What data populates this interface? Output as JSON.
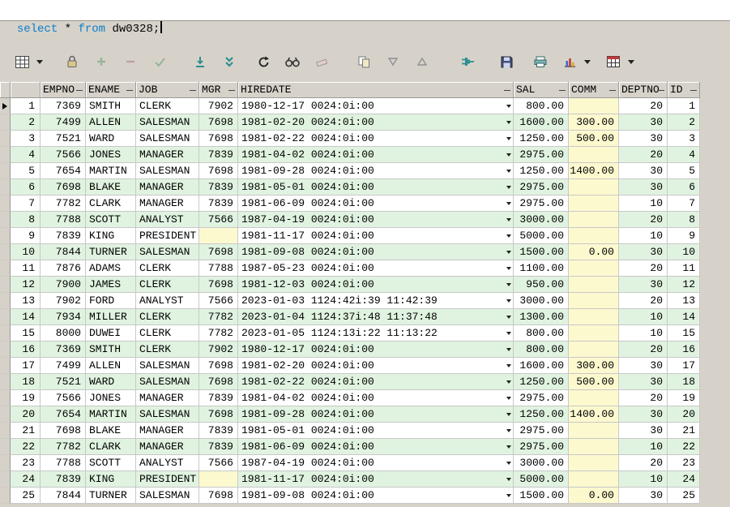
{
  "sql_editor": {
    "tokens": [
      {
        "text": "select ",
        "type": "keyword"
      },
      {
        "text": "* ",
        "type": "plain"
      },
      {
        "text": "from ",
        "type": "keyword"
      },
      {
        "text": "dw0328;",
        "type": "plain"
      }
    ]
  },
  "toolbar": {
    "buttons": [
      {
        "name": "table-view",
        "icon": "grid",
        "dropdown": true,
        "gap": 0
      },
      {
        "name": "lock",
        "icon": "lock",
        "dropdown": false,
        "gap": 18
      },
      {
        "name": "insert-row",
        "icon": "plus",
        "dropdown": false,
        "gap": 6
      },
      {
        "name": "delete-row",
        "icon": "minus",
        "dropdown": false,
        "gap": 6
      },
      {
        "name": "accept-changes",
        "icon": "check",
        "dropdown": false,
        "gap": 6
      },
      {
        "name": "retrieve-to-row",
        "icon": "down-bar",
        "dropdown": false,
        "gap": 20
      },
      {
        "name": "retrieve-all",
        "icon": "down-double",
        "dropdown": false,
        "gap": 6
      },
      {
        "name": "refresh",
        "icon": "refresh",
        "dropdown": false,
        "gap": 12
      },
      {
        "name": "find",
        "icon": "binoculars",
        "dropdown": false,
        "gap": 6
      },
      {
        "name": "erase",
        "icon": "eraser",
        "dropdown": false,
        "gap": 6
      },
      {
        "name": "export-data",
        "icon": "copy",
        "dropdown": false,
        "gap": 22
      },
      {
        "name": "sort-descending",
        "icon": "tri-down",
        "dropdown": false,
        "gap": 6
      },
      {
        "name": "sort-ascending",
        "icon": "tri-up",
        "dropdown": false,
        "gap": 6
      },
      {
        "name": "connect",
        "icon": "plug",
        "dropdown": false,
        "gap": 26
      },
      {
        "name": "save",
        "icon": "save",
        "dropdown": false,
        "gap": 18
      },
      {
        "name": "print",
        "icon": "printer",
        "dropdown": false,
        "gap": 12
      },
      {
        "name": "chart-view",
        "icon": "chart",
        "dropdown": true,
        "gap": 6
      },
      {
        "name": "grid-view",
        "icon": "table-red",
        "dropdown": true,
        "gap": 10
      }
    ]
  },
  "grid": {
    "current_row": 1,
    "columns": [
      {
        "key": "empno",
        "label": "EMPNO",
        "align": "right"
      },
      {
        "key": "ename",
        "label": "ENAME",
        "align": "left"
      },
      {
        "key": "job",
        "label": "JOB",
        "align": "left"
      },
      {
        "key": "mgr",
        "label": "MGR",
        "align": "right"
      },
      {
        "key": "hiredate",
        "label": "HIREDATE",
        "align": "left"
      },
      {
        "key": "sal",
        "label": "SAL",
        "align": "right"
      },
      {
        "key": "comm",
        "label": "COMM",
        "align": "right"
      },
      {
        "key": "deptno",
        "label": "DEPTNO",
        "align": "right"
      },
      {
        "key": "id",
        "label": "ID",
        "align": "right"
      }
    ],
    "rows": [
      {
        "row": 1,
        "empno": "7369",
        "ename": "SMITH",
        "job": "CLERK",
        "mgr": "7902",
        "hiredate": "1980-12-17 0024:0i:00",
        "sal": "800.00",
        "comm": "",
        "deptno": "20",
        "id": "1"
      },
      {
        "row": 2,
        "empno": "7499",
        "ename": "ALLEN",
        "job": "SALESMAN",
        "mgr": "7698",
        "hiredate": "1981-02-20 0024:0i:00",
        "sal": "1600.00",
        "comm": "300.00",
        "deptno": "30",
        "id": "2"
      },
      {
        "row": 3,
        "empno": "7521",
        "ename": "WARD",
        "job": "SALESMAN",
        "mgr": "7698",
        "hiredate": "1981-02-22 0024:0i:00",
        "sal": "1250.00",
        "comm": "500.00",
        "deptno": "30",
        "id": "3"
      },
      {
        "row": 4,
        "empno": "7566",
        "ename": "JONES",
        "job": "MANAGER",
        "mgr": "7839",
        "hiredate": "1981-04-02 0024:0i:00",
        "sal": "2975.00",
        "comm": "",
        "deptno": "20",
        "id": "4"
      },
      {
        "row": 5,
        "empno": "7654",
        "ename": "MARTIN",
        "job": "SALESMAN",
        "mgr": "7698",
        "hiredate": "1981-09-28 0024:0i:00",
        "sal": "1250.00",
        "comm": "1400.00",
        "deptno": "30",
        "id": "5"
      },
      {
        "row": 6,
        "empno": "7698",
        "ename": "BLAKE",
        "job": "MANAGER",
        "mgr": "7839",
        "hiredate": "1981-05-01 0024:0i:00",
        "sal": "2975.00",
        "comm": "",
        "deptno": "30",
        "id": "6"
      },
      {
        "row": 7,
        "empno": "7782",
        "ename": "CLARK",
        "job": "MANAGER",
        "mgr": "7839",
        "hiredate": "1981-06-09 0024:0i:00",
        "sal": "2975.00",
        "comm": "",
        "deptno": "10",
        "id": "7"
      },
      {
        "row": 8,
        "empno": "7788",
        "ename": "SCOTT",
        "job": "ANALYST",
        "mgr": "7566",
        "hiredate": "1987-04-19 0024:0i:00",
        "sal": "3000.00",
        "comm": "",
        "deptno": "20",
        "id": "8"
      },
      {
        "row": 9,
        "empno": "7839",
        "ename": "KING",
        "job": "PRESIDENT",
        "mgr": "",
        "hiredate": "1981-11-17 0024:0i:00",
        "sal": "5000.00",
        "comm": "",
        "deptno": "10",
        "id": "9"
      },
      {
        "row": 10,
        "empno": "7844",
        "ename": "TURNER",
        "job": "SALESMAN",
        "mgr": "7698",
        "hiredate": "1981-09-08 0024:0i:00",
        "sal": "1500.00",
        "comm": "0.00",
        "deptno": "30",
        "id": "10"
      },
      {
        "row": 11,
        "empno": "7876",
        "ename": "ADAMS",
        "job": "CLERK",
        "mgr": "7788",
        "hiredate": "1987-05-23 0024:0i:00",
        "sal": "1100.00",
        "comm": "",
        "deptno": "20",
        "id": "11"
      },
      {
        "row": 12,
        "empno": "7900",
        "ename": "JAMES",
        "job": "CLERK",
        "mgr": "7698",
        "hiredate": "1981-12-03 0024:0i:00",
        "sal": "950.00",
        "comm": "",
        "deptno": "30",
        "id": "12"
      },
      {
        "row": 13,
        "empno": "7902",
        "ename": "FORD",
        "job": "ANALYST",
        "mgr": "7566",
        "hiredate": "2023-01-03 1124:42i:39 11:42:39",
        "sal": "3000.00",
        "comm": "",
        "deptno": "20",
        "id": "13"
      },
      {
        "row": 14,
        "empno": "7934",
        "ename": "MILLER",
        "job": "CLERK",
        "mgr": "7782",
        "hiredate": "2023-01-04 1124:37i:48 11:37:48",
        "sal": "1300.00",
        "comm": "",
        "deptno": "10",
        "id": "14"
      },
      {
        "row": 15,
        "empno": "8000",
        "ename": "DUWEI",
        "job": "CLERK",
        "mgr": "7782",
        "hiredate": "2023-01-05 1124:13i:22 11:13:22",
        "sal": "800.00",
        "comm": "",
        "deptno": "10",
        "id": "15"
      },
      {
        "row": 16,
        "empno": "7369",
        "ename": "SMITH",
        "job": "CLERK",
        "mgr": "7902",
        "hiredate": "1980-12-17 0024:0i:00",
        "sal": "800.00",
        "comm": "",
        "deptno": "20",
        "id": "16"
      },
      {
        "row": 17,
        "empno": "7499",
        "ename": "ALLEN",
        "job": "SALESMAN",
        "mgr": "7698",
        "hiredate": "1981-02-20 0024:0i:00",
        "sal": "1600.00",
        "comm": "300.00",
        "deptno": "30",
        "id": "17"
      },
      {
        "row": 18,
        "empno": "7521",
        "ename": "WARD",
        "job": "SALESMAN",
        "mgr": "7698",
        "hiredate": "1981-02-22 0024:0i:00",
        "sal": "1250.00",
        "comm": "500.00",
        "deptno": "30",
        "id": "18"
      },
      {
        "row": 19,
        "empno": "7566",
        "ename": "JONES",
        "job": "MANAGER",
        "mgr": "7839",
        "hiredate": "1981-04-02 0024:0i:00",
        "sal": "2975.00",
        "comm": "",
        "deptno": "20",
        "id": "19"
      },
      {
        "row": 20,
        "empno": "7654",
        "ename": "MARTIN",
        "job": "SALESMAN",
        "mgr": "7698",
        "hiredate": "1981-09-28 0024:0i:00",
        "sal": "1250.00",
        "comm": "1400.00",
        "deptno": "30",
        "id": "20"
      },
      {
        "row": 21,
        "empno": "7698",
        "ename": "BLAKE",
        "job": "MANAGER",
        "mgr": "7839",
        "hiredate": "1981-05-01 0024:0i:00",
        "sal": "2975.00",
        "comm": "",
        "deptno": "30",
        "id": "21"
      },
      {
        "row": 22,
        "empno": "7782",
        "ename": "CLARK",
        "job": "MANAGER",
        "mgr": "7839",
        "hiredate": "1981-06-09 0024:0i:00",
        "sal": "2975.00",
        "comm": "",
        "deptno": "10",
        "id": "22"
      },
      {
        "row": 23,
        "empno": "7788",
        "ename": "SCOTT",
        "job": "ANALYST",
        "mgr": "7566",
        "hiredate": "1987-04-19 0024:0i:00",
        "sal": "3000.00",
        "comm": "",
        "deptno": "20",
        "id": "23"
      },
      {
        "row": 24,
        "empno": "7839",
        "ename": "KING",
        "job": "PRESIDENT",
        "mgr": "",
        "hiredate": "1981-11-17 0024:0i:00",
        "sal": "5000.00",
        "comm": "",
        "deptno": "10",
        "id": "24"
      },
      {
        "row": 25,
        "empno": "7844",
        "ename": "TURNER",
        "job": "SALESMAN",
        "mgr": "7698",
        "hiredate": "1981-09-08 0024:0i:00",
        "sal": "1500.00",
        "comm": "0.00",
        "deptno": "30",
        "id": "25"
      }
    ]
  },
  "colors": {
    "keyword_blue": "#0a7ec8",
    "stripe_green": "#e0f3e0",
    "null_yellow": "#fcf9cf",
    "toolbar_teal": "#2e8f8f",
    "window_gray": "#d6d2ca"
  }
}
